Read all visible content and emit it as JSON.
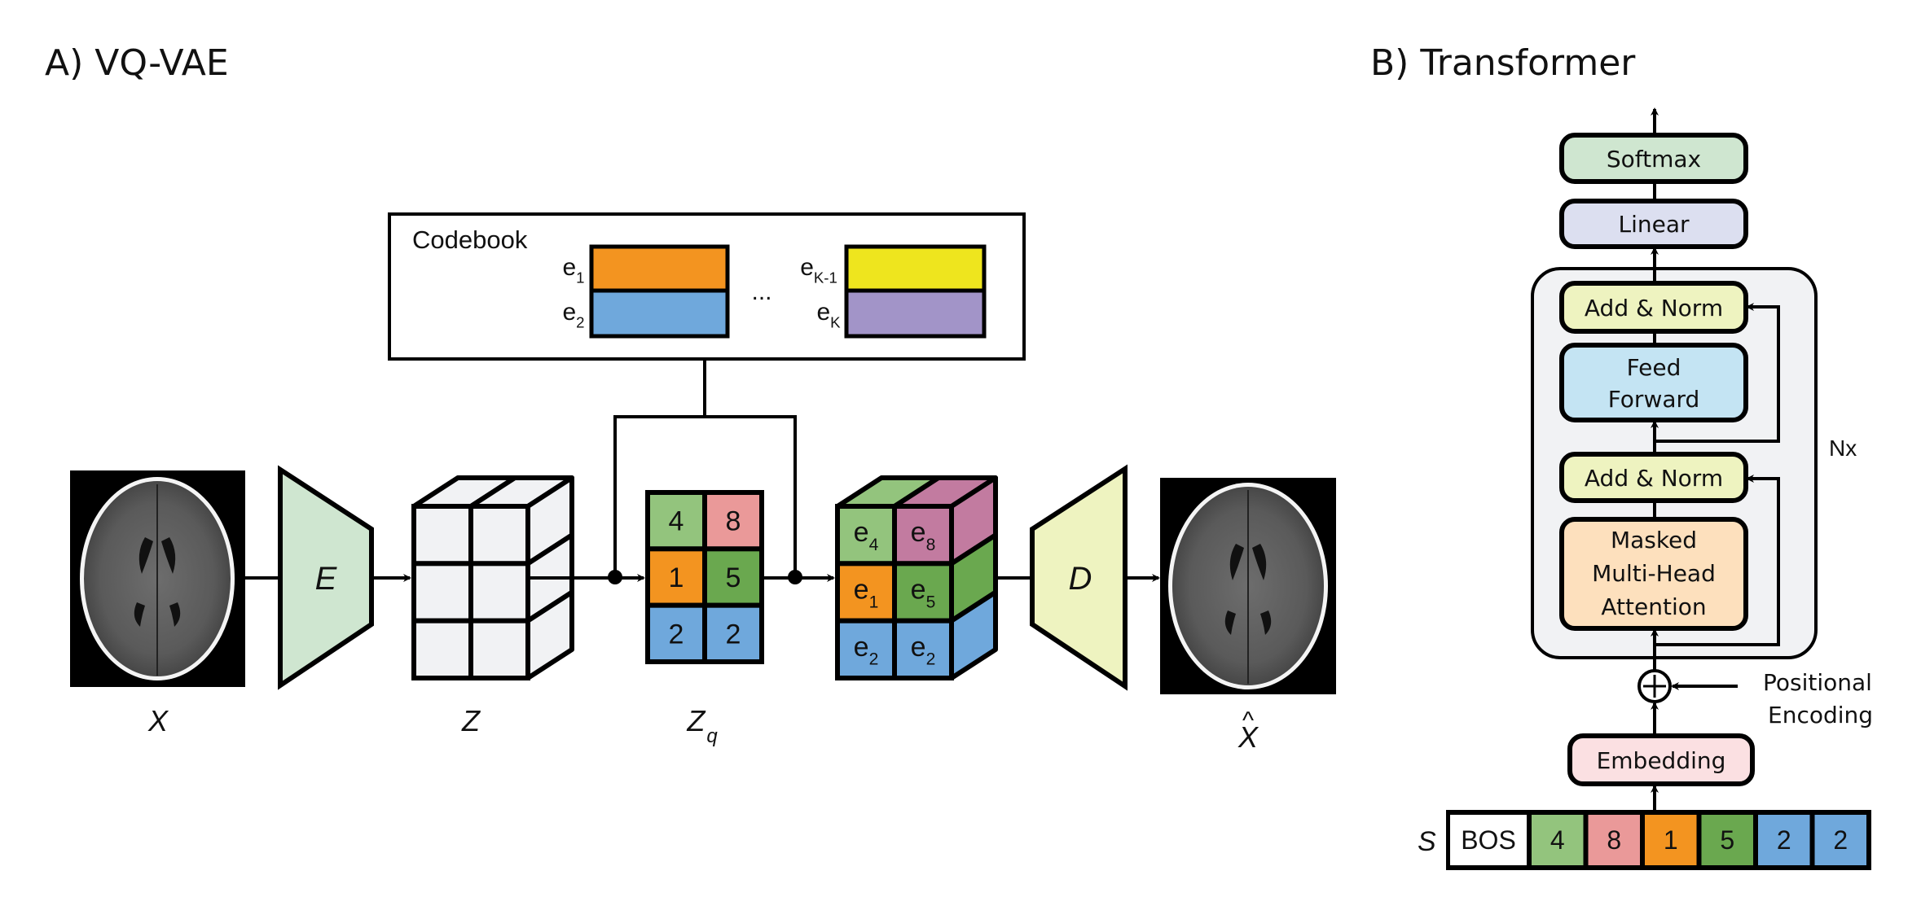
{
  "panels": {
    "vqvae": {
      "title": "A) VQ-VAE"
    },
    "transformer": {
      "title": "B) Transformer"
    }
  },
  "vqvae": {
    "input_label": "X",
    "encoder_label": "E",
    "latent_label": "Z",
    "quantized_label_main": "Z",
    "quantized_label_sub": "q",
    "decoder_label": "D",
    "output_label": "X",
    "output_hat": "^",
    "codebook": {
      "title": "Codebook",
      "ellipsis": "...",
      "entries": [
        {
          "name": "e",
          "sub": "1",
          "color": "#f39420"
        },
        {
          "name": "e",
          "sub": "2",
          "color": "#6fa8dc"
        },
        {
          "name": "e",
          "sub": "K-1",
          "color": "#eee51e"
        },
        {
          "name": "e",
          "sub": "K",
          "color": "#a294c8"
        }
      ]
    },
    "quantized_grid": [
      {
        "value": "4",
        "color": "#93c47d"
      },
      {
        "value": "8",
        "color": "#ea9999"
      },
      {
        "value": "1",
        "color": "#f39420"
      },
      {
        "value": "5",
        "color": "#6aa84f"
      },
      {
        "value": "2",
        "color": "#6fa8dc"
      },
      {
        "value": "2",
        "color": "#6fa8dc"
      }
    ],
    "embedded_cube": [
      {
        "name": "e",
        "sub": "4",
        "color": "#93c47d"
      },
      {
        "name": "e",
        "sub": "8",
        "color": "#c27ba0"
      },
      {
        "name": "e",
        "sub": "1",
        "color": "#f39420"
      },
      {
        "name": "e",
        "sub": "5",
        "color": "#6aa84f"
      },
      {
        "name": "e",
        "sub": "2",
        "color": "#6fa8dc"
      },
      {
        "name": "e",
        "sub": "2",
        "color": "#6fa8dc"
      }
    ],
    "colors": {
      "encoder_fill": "#cfe6d0",
      "decoder_fill": "#eef3c0",
      "latent_fill": "#f1f2f4"
    }
  },
  "transformer": {
    "blocks": {
      "softmax": {
        "label": "Softmax",
        "color": "#cfe6d0"
      },
      "linear": {
        "label": "Linear",
        "color": "#dcdff0"
      },
      "add_norm_top": {
        "label": "Add & Norm",
        "color": "#eef3c0"
      },
      "feed_forward": {
        "line1": "Feed",
        "line2": "Forward",
        "color": "#c4e4f3"
      },
      "add_norm_bottom": {
        "label": "Add & Norm",
        "color": "#eef3c0"
      },
      "attention": {
        "line1": "Masked",
        "line2": "Multi-Head",
        "line3": "Attention",
        "color": "#fde0bd"
      },
      "embedding": {
        "label": "Embedding",
        "color": "#fbe0e2"
      }
    },
    "repeat_label": "Nx",
    "positional_encoding": {
      "line1": "Positional",
      "line2": "Encoding"
    },
    "sequence_label": "S",
    "sequence": [
      {
        "value": "BOS",
        "color": "#ffffff"
      },
      {
        "value": "4",
        "color": "#93c47d"
      },
      {
        "value": "8",
        "color": "#ea9999"
      },
      {
        "value": "1",
        "color": "#f39420"
      },
      {
        "value": "5",
        "color": "#6aa84f"
      },
      {
        "value": "2",
        "color": "#6fa8dc"
      },
      {
        "value": "2",
        "color": "#6fa8dc"
      }
    ],
    "container_color": "#f1f2f4"
  }
}
